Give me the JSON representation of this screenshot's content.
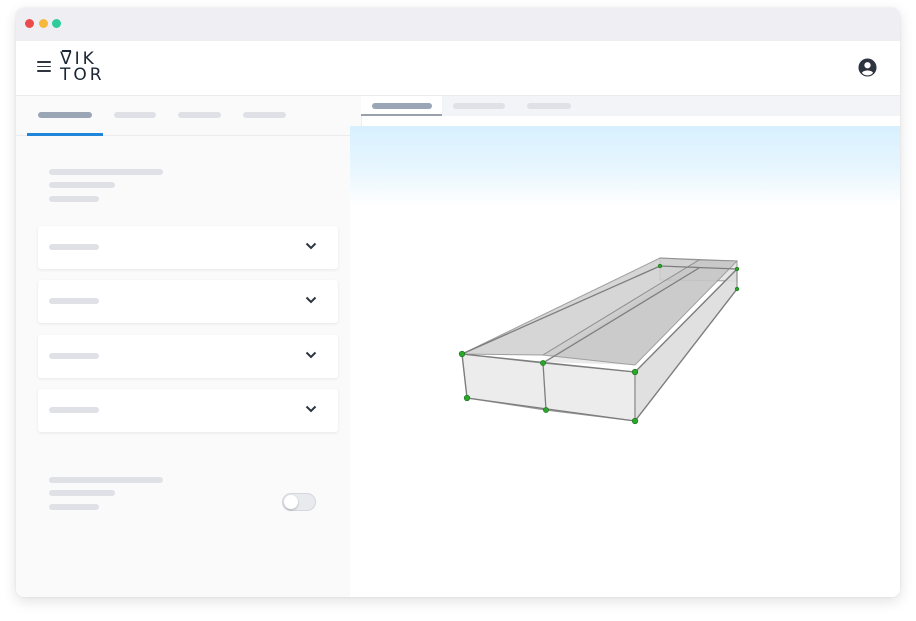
{
  "app": {
    "logo_line1": "VIK",
    "logo_line2": "TOR"
  },
  "colors": {
    "accent": "#1f86d9",
    "traffic_red": "#ec4b4b",
    "traffic_yellow": "#f6b93b",
    "traffic_green": "#2ecc9a",
    "node_green": "#2aa82a"
  },
  "icons": {
    "menu": "hamburger-icon",
    "user": "user-circle-icon",
    "chevron": "chevron-down-icon"
  },
  "sidebar": {
    "tabs": [
      {
        "active": true
      },
      {
        "active": false
      },
      {
        "active": false
      },
      {
        "active": false
      }
    ],
    "sections": [
      {
        "expanded": false
      },
      {
        "expanded": false
      },
      {
        "expanded": false
      },
      {
        "expanded": false
      }
    ],
    "toggle": {
      "on": false
    }
  },
  "viewer": {
    "tabs": [
      {
        "active": true
      },
      {
        "active": false
      },
      {
        "active": false
      }
    ],
    "model": "3d-box-girder"
  }
}
